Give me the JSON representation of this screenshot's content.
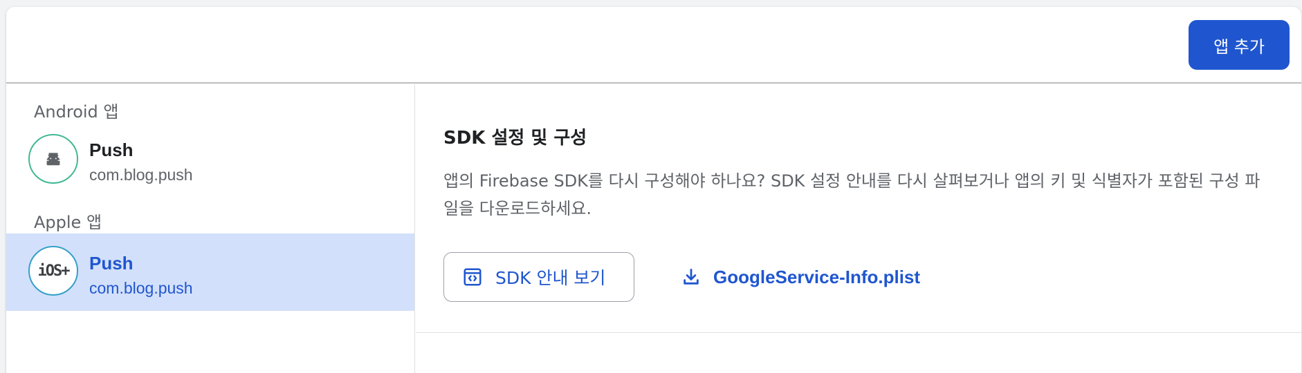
{
  "header": {
    "add_app_label": "앱 추가"
  },
  "sidebar": {
    "android_section": "Android 앱",
    "apple_section": "Apple 앱",
    "apps": [
      {
        "platform": "android",
        "icon": "android-icon",
        "name": "Push",
        "package": "com.blog.push",
        "selected": false
      },
      {
        "platform": "ios",
        "icon": "ios-plus-icon",
        "icon_text": "iOS+",
        "name": "Push",
        "package": "com.blog.push",
        "selected": true
      }
    ]
  },
  "main": {
    "title": "SDK 설정 및 구성",
    "description": "앱의 Firebase SDK를 다시 구성해야 하나요? SDK 설정 안내를 다시 살펴보거나 앱의 키 및 식별자가 포함된 구성 파일을 다운로드하세요.",
    "sdk_button_label": "SDK 안내 보기",
    "sdk_button_icon": "code-window-icon",
    "download_label": "GoogleService-Info.plist",
    "download_icon": "download-icon"
  },
  "colors": {
    "accent": "#1f56cf",
    "selected_bg": "#d3e0fb",
    "android_ring": "#42b894",
    "ios_ring": "#34a0c9"
  }
}
